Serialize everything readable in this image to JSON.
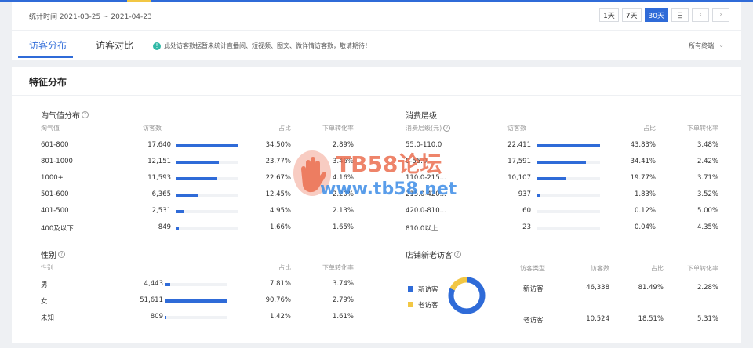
{
  "header": {
    "date_range": "统计时间 2021-03-25 ~ 2021-04-23",
    "day_buttons": [
      "1天",
      "7天",
      "30天",
      "日"
    ],
    "active_day": "30天"
  },
  "tabs": [
    {
      "label": "访客分布",
      "active": true
    },
    {
      "label": "访客对比",
      "active": false
    }
  ],
  "notice": "此处访客数据暂未统计直播间、短视频、图文、微详情访客数，敬请期待！",
  "terminal_select": "所有终端",
  "panel_title": "特征分布",
  "taoqi": {
    "title": "淘气值分布",
    "columns": [
      "淘气值",
      "访客数",
      "占比",
      "下单转化率"
    ],
    "rows": [
      {
        "label": "601-800",
        "visitors": "17,640",
        "share": "34.50%",
        "rate": "2.89%",
        "ratio": 1.0
      },
      {
        "label": "801-1000",
        "visitors": "12,151",
        "share": "23.77%",
        "rate": "3.46%",
        "ratio": 0.69
      },
      {
        "label": "1000+",
        "visitors": "11,593",
        "share": "22.67%",
        "rate": "4.16%",
        "ratio": 0.66
      },
      {
        "label": "501-600",
        "visitors": "6,365",
        "share": "12.45%",
        "rate": "2.20%",
        "ratio": 0.36
      },
      {
        "label": "401-500",
        "visitors": "2,531",
        "share": "4.95%",
        "rate": "2.13%",
        "ratio": 0.14
      },
      {
        "label": "400及以下",
        "visitors": "849",
        "share": "1.66%",
        "rate": "1.65%",
        "ratio": 0.05
      }
    ]
  },
  "consume": {
    "title": "消费层级",
    "columns": [
      "消费层级(元)",
      "访客数",
      "占比",
      "下单转化率"
    ],
    "rows": [
      {
        "label": "55.0-110.0",
        "visitors": "22,411",
        "share": "43.83%",
        "rate": "3.48%",
        "ratio": 1.0
      },
      {
        "label": "0-55.0",
        "visitors": "17,591",
        "share": "34.41%",
        "rate": "2.42%",
        "ratio": 0.78
      },
      {
        "label": "110.0-215...",
        "visitors": "10,107",
        "share": "19.77%",
        "rate": "3.71%",
        "ratio": 0.45
      },
      {
        "label": "215.0-420...",
        "visitors": "937",
        "share": "1.83%",
        "rate": "3.52%",
        "ratio": 0.04
      },
      {
        "label": "420.0-810...",
        "visitors": "60",
        "share": "0.12%",
        "rate": "5.00%",
        "ratio": 0.0
      },
      {
        "label": "810.0以上",
        "visitors": "23",
        "share": "0.04%",
        "rate": "4.35%",
        "ratio": 0.0
      }
    ]
  },
  "gender": {
    "title": "性别",
    "columns": [
      "性别",
      "占比",
      "下单转化率"
    ],
    "rows": [
      {
        "label": "男",
        "visitors": "4,443",
        "share": "7.81%",
        "rate": "3.74%",
        "ratio": 0.09
      },
      {
        "label": "女",
        "visitors": "51,611",
        "share": "90.76%",
        "rate": "2.79%",
        "ratio": 1.0
      },
      {
        "label": "未知",
        "visitors": "809",
        "share": "1.42%",
        "rate": "1.61%",
        "ratio": 0.02
      }
    ]
  },
  "newold": {
    "title": "店铺新老访客",
    "legend": [
      {
        "label": "新访客",
        "color": "#2f6bd8"
      },
      {
        "label": "老访客",
        "color": "#f2c744"
      }
    ],
    "donut_new_fraction": 0.8149,
    "columns": [
      "访客类型",
      "访客数",
      "占比",
      "下单转化率"
    ],
    "rows": [
      {
        "label": "新访客",
        "visitors": "46,338",
        "share": "81.49%",
        "rate": "2.28%"
      },
      {
        "label": "老访客",
        "visitors": "10,524",
        "share": "18.51%",
        "rate": "5.31%"
      }
    ]
  },
  "watermark": {
    "line1": "TB58论坛",
    "line2": "www.tb58.net"
  },
  "colors": {
    "accent": "#2f6bd8",
    "old_visitor": "#f2c744",
    "bar_track": "#f0f2f5"
  }
}
